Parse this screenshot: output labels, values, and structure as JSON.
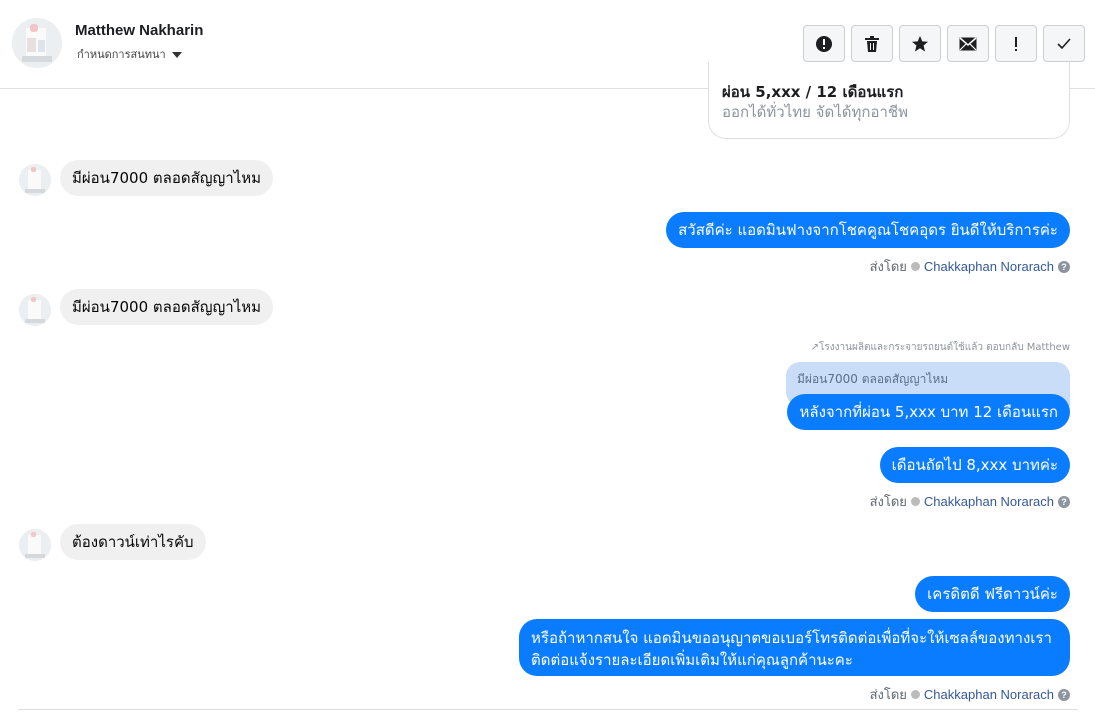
{
  "header": {
    "contact_name": "Matthew Nakharin",
    "contact_sub": "กำหนดการสนทนา",
    "toolbar": [
      {
        "name": "report-button",
        "icon": "alert-circle-icon"
      },
      {
        "name": "delete-button",
        "icon": "trash-icon"
      },
      {
        "name": "star-button",
        "icon": "star-icon"
      },
      {
        "name": "mark-unread-button",
        "icon": "envelope-icon"
      },
      {
        "name": "important-button",
        "icon": "exclamation-icon"
      },
      {
        "name": "done-button",
        "icon": "checkmark-icon"
      }
    ]
  },
  "card": {
    "title": "ผ่อน 5,xxx / 12 เดือนแรก",
    "subtitle": "ออกได้ทั่วไทย จัดได้ทุกอาชีพ"
  },
  "messages": {
    "in1": "มีผ่อน7000 ตลอดสัญญาไหม",
    "out1": "สวัสดีค่ะ แอดมินฟางจากโชคคูณโชคอุดร ยินดีให้บริการค่ะ",
    "in2": "มีผ่อน7000 ตลอดสัญญาไหม",
    "reply_note": "↗โรงงานผลิตและกระจายรถยนต์ใช้แล้ว ตอบกลับ Matthew",
    "quoted": "มีผ่อน7000 ตลอดสัญญาไหม",
    "out2": "หลังจากที่ผ่อน 5,xxx บาท 12 เดือนแรก",
    "out3": "เดือนถัดไป 8,xxx บาทค่ะ",
    "in3": "ต้องดาวน์เท่าไรคับ",
    "out4": "เครดิตดี ฟรีดาวน์ค่ะ",
    "out5": "หรือถ้าหากสนใจ แอดมินขออนุญาตขอเบอร์โทรติดต่อเพื่อที่จะให้เซลล์ของทางเราติดต่อแจ้งรายละเอียดเพิ่มเติมให้แก่คุณลูกค้านะคะ"
  },
  "sent_by": {
    "prefix": "ส่งโดย",
    "agent": "Chakkaphan Norarach",
    "help": "?"
  },
  "colors": {
    "outgoing": "#0a7cff",
    "incoming": "#f0f0f0",
    "agent_link": "#365899"
  }
}
